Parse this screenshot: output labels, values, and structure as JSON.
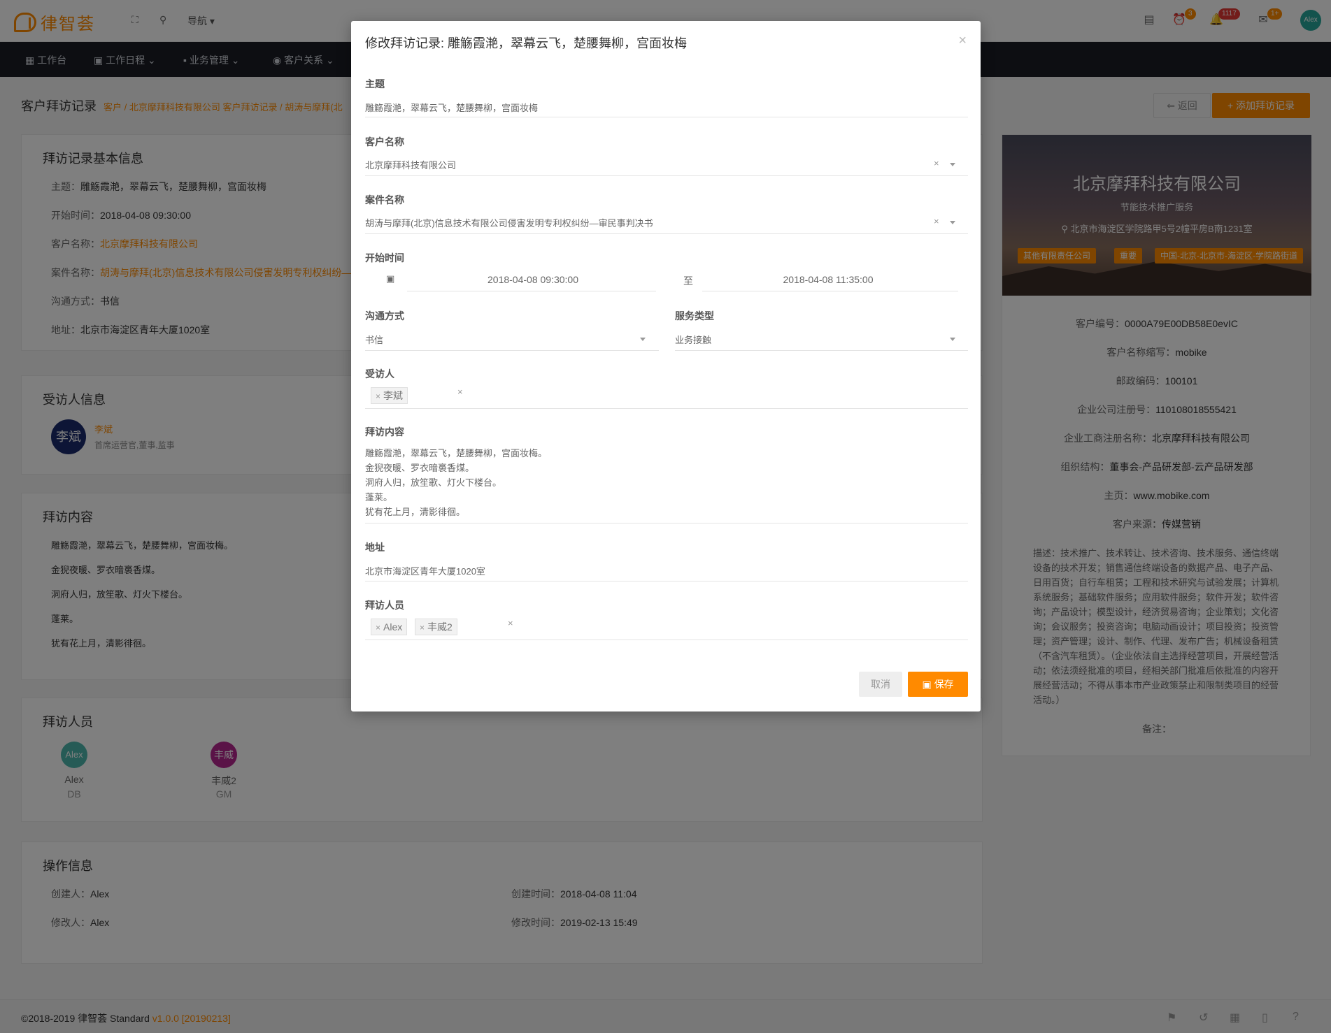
{
  "app": {
    "logo_text": "律智荟",
    "nav_label": "导航",
    "avatar_text": "Alex"
  },
  "badges": {
    "alarm": "3",
    "bell": "1117",
    "mail": "1+"
  },
  "menu": [
    "工作台",
    "工作日程",
    "业务管理",
    "客户关系"
  ],
  "breadcrumb": {
    "title": "客户拜访记录",
    "links": "客户 / 北京摩拜科技有限公司 客户拜访记录 / 胡涛与摩拜(北"
  },
  "header_buttons": {
    "back": "返回",
    "add": "+ 添加拜访记录"
  },
  "basic_info": {
    "title": "拜访记录基本信息",
    "subject_k": "主题：",
    "subject_v": "雕觞霞滟，翠幕云飞，楚腰舞柳，宫面妆梅",
    "start_k": "开始时间：",
    "start_v": "2018-04-08 09:30:00",
    "client_k": "客户名称：",
    "client_v": "北京摩拜科技有限公司",
    "case_k": "案件名称：",
    "case_v": "胡涛与摩拜(北京)信息技术有限公司侵害发明专利权纠纷—",
    "method_k": "沟通方式：",
    "method_v": "书信",
    "addr_k": "地址：",
    "addr_v": "北京市海淀区青年大厦1020室"
  },
  "visitee": {
    "title": "受访人信息",
    "avatar": "李斌",
    "name": "李斌",
    "role": "首席运营官,董事,监事"
  },
  "visit_content": {
    "title": "拜访内容",
    "lines": [
      "雕觞霞滟，翠幕云飞，楚腰舞柳，宫面妆梅。",
      "金猊夜暖、罗衣暗裛香煤。",
      "洞府人归，放笙歌、灯火下楼台。",
      "蓬莱。",
      "犹有花上月，清影徘徊。"
    ]
  },
  "visitors": {
    "title": "拜访人员",
    "people": [
      {
        "avatar": "Alex",
        "name": "Alex",
        "role": "DB"
      },
      {
        "avatar": "丰威",
        "name": "丰威2",
        "role": "GM"
      }
    ]
  },
  "ops": {
    "title": "操作信息",
    "creator_k": "创建人：",
    "creator_v": "Alex",
    "modifier_k": "修改人：",
    "modifier_v": "Alex",
    "created_k": "创建时间：",
    "created_v": "2018-04-08 11:04",
    "modified_k": "修改时间：",
    "modified_v": "2019-02-13 15:49"
  },
  "company": {
    "name": "北京摩拜科技有限公司",
    "sub": "节能技术推广服务",
    "addr": "北京市海淀区学院路甲5号2幢平房B南1231室",
    "tags": [
      "其他有限责任公司",
      "重要",
      "中国-北京-北京市-海淀区-学院路街道"
    ],
    "code_k": "客户编号：",
    "code_v": "0000A79E00DB58E0evIC",
    "abbr_k": "客户名称缩写：",
    "abbr_v": "mobike",
    "zip_k": "邮政编码：",
    "zip_v": "100101",
    "reg_k": "企业公司注册号：",
    "reg_v": "110108018555421",
    "regname_k": "企业工商注册名称：",
    "regname_v": "北京摩拜科技有限公司",
    "org_k": "组织结构：",
    "org_v": "董事会-产品研发部-云产品研发部",
    "home_k": "主页：",
    "home_v": "www.mobike.com",
    "source_k": "客户来源：",
    "source_v": "传媒营销",
    "desc": "描述：技术推广、技术转让、技术咨询、技术服务、通信终端设备的技术开发；销售通信终端设备的数据产品、电子产品、日用百货；自行车租赁；工程和技术研究与试验发展；计算机系统服务；基础软件服务；应用软件服务；软件开发；软件咨询；产品设计；模型设计，经济贸易咨询；企业策划；文化咨询；会议服务；投资咨询；电脑动画设计；项目投资；投资管理；资产管理；设计、制作、代理、发布广告；机械设备租赁（不含汽车租赁）。（企业依法自主选择经营项目，开展经营活动；依法须经批准的项目，经相关部门批准后依批准的内容开展经营活动；不得从事本市产业政策禁止和限制类项目的经营活动。）",
    "note_k": "备注："
  },
  "footer": {
    "copy": "©2018-2019 律智荟  Standard ",
    "version": "v1.0.0 [20190213]"
  },
  "modal": {
    "title": "修改拜访记录: 雕觞霞滟，翠幕云飞，楚腰舞柳，宫面妆梅",
    "subject_label": "主题",
    "subject_value": "雕觞霞滟，翠幕云飞，楚腰舞柳，宫面妆梅",
    "client_label": "客户名称",
    "client_value": "北京摩拜科技有限公司",
    "case_label": "案件名称",
    "case_value": "胡涛与摩拜(北京)信息技术有限公司侵害发明专利权纠纷—审民事判决书",
    "time_label": "开始时间",
    "time_start": "2018-04-08 09:30:00",
    "time_sep": "至",
    "time_end": "2018-04-08 11:35:00",
    "method_label": "沟通方式",
    "method_value": "书信",
    "service_label": "服务类型",
    "service_value": "业务接触",
    "visitee_label": "受访人",
    "visitee_chip": "李斌",
    "content_label": "拜访内容",
    "content_value": "雕觞霞滟，翠幕云飞，楚腰舞柳，宫面妆梅。\n金猊夜暖、罗衣暗裛香煤。\n洞府人归，放笙歌、灯火下楼台。\n蓬莱。\n犹有花上月，清影徘徊。",
    "addr_label": "地址",
    "addr_value": "北京市海淀区青年大厦1020室",
    "visitors_label": "拜访人员",
    "visitor_chips": [
      "Alex",
      "丰威2"
    ],
    "cancel": "取消",
    "save": "保存"
  },
  "colors": {
    "accent": "#ff8a00",
    "menubar": "#1b1d24",
    "overlay": "rgba(0,0,0,0.5)"
  }
}
